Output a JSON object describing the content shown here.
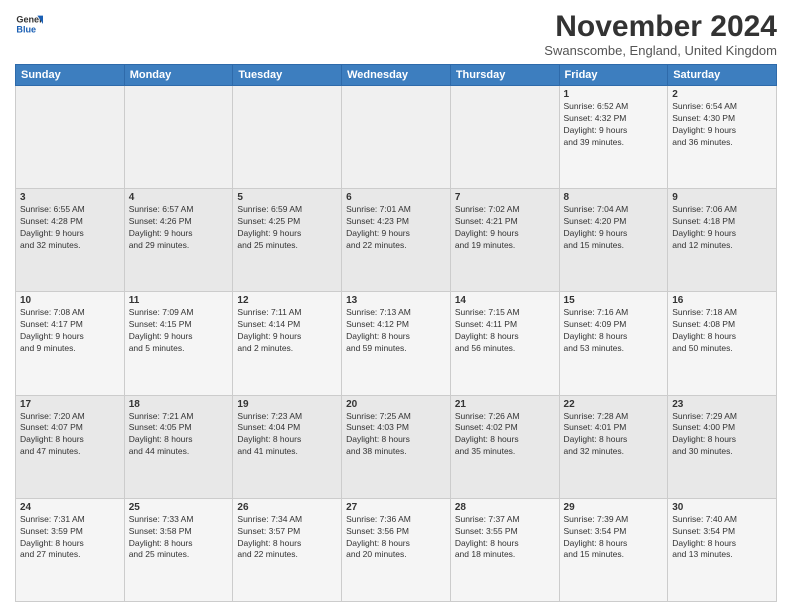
{
  "logo": {
    "line1": "General",
    "line2": "Blue"
  },
  "title": "November 2024",
  "location": "Swanscombe, England, United Kingdom",
  "weekdays": [
    "Sunday",
    "Monday",
    "Tuesday",
    "Wednesday",
    "Thursday",
    "Friday",
    "Saturday"
  ],
  "weeks": [
    [
      {
        "day": "",
        "info": ""
      },
      {
        "day": "",
        "info": ""
      },
      {
        "day": "",
        "info": ""
      },
      {
        "day": "",
        "info": ""
      },
      {
        "day": "",
        "info": ""
      },
      {
        "day": "1",
        "info": "Sunrise: 6:52 AM\nSunset: 4:32 PM\nDaylight: 9 hours\nand 39 minutes."
      },
      {
        "day": "2",
        "info": "Sunrise: 6:54 AM\nSunset: 4:30 PM\nDaylight: 9 hours\nand 36 minutes."
      }
    ],
    [
      {
        "day": "3",
        "info": "Sunrise: 6:55 AM\nSunset: 4:28 PM\nDaylight: 9 hours\nand 32 minutes."
      },
      {
        "day": "4",
        "info": "Sunrise: 6:57 AM\nSunset: 4:26 PM\nDaylight: 9 hours\nand 29 minutes."
      },
      {
        "day": "5",
        "info": "Sunrise: 6:59 AM\nSunset: 4:25 PM\nDaylight: 9 hours\nand 25 minutes."
      },
      {
        "day": "6",
        "info": "Sunrise: 7:01 AM\nSunset: 4:23 PM\nDaylight: 9 hours\nand 22 minutes."
      },
      {
        "day": "7",
        "info": "Sunrise: 7:02 AM\nSunset: 4:21 PM\nDaylight: 9 hours\nand 19 minutes."
      },
      {
        "day": "8",
        "info": "Sunrise: 7:04 AM\nSunset: 4:20 PM\nDaylight: 9 hours\nand 15 minutes."
      },
      {
        "day": "9",
        "info": "Sunrise: 7:06 AM\nSunset: 4:18 PM\nDaylight: 9 hours\nand 12 minutes."
      }
    ],
    [
      {
        "day": "10",
        "info": "Sunrise: 7:08 AM\nSunset: 4:17 PM\nDaylight: 9 hours\nand 9 minutes."
      },
      {
        "day": "11",
        "info": "Sunrise: 7:09 AM\nSunset: 4:15 PM\nDaylight: 9 hours\nand 5 minutes."
      },
      {
        "day": "12",
        "info": "Sunrise: 7:11 AM\nSunset: 4:14 PM\nDaylight: 9 hours\nand 2 minutes."
      },
      {
        "day": "13",
        "info": "Sunrise: 7:13 AM\nSunset: 4:12 PM\nDaylight: 8 hours\nand 59 minutes."
      },
      {
        "day": "14",
        "info": "Sunrise: 7:15 AM\nSunset: 4:11 PM\nDaylight: 8 hours\nand 56 minutes."
      },
      {
        "day": "15",
        "info": "Sunrise: 7:16 AM\nSunset: 4:09 PM\nDaylight: 8 hours\nand 53 minutes."
      },
      {
        "day": "16",
        "info": "Sunrise: 7:18 AM\nSunset: 4:08 PM\nDaylight: 8 hours\nand 50 minutes."
      }
    ],
    [
      {
        "day": "17",
        "info": "Sunrise: 7:20 AM\nSunset: 4:07 PM\nDaylight: 8 hours\nand 47 minutes."
      },
      {
        "day": "18",
        "info": "Sunrise: 7:21 AM\nSunset: 4:05 PM\nDaylight: 8 hours\nand 44 minutes."
      },
      {
        "day": "19",
        "info": "Sunrise: 7:23 AM\nSunset: 4:04 PM\nDaylight: 8 hours\nand 41 minutes."
      },
      {
        "day": "20",
        "info": "Sunrise: 7:25 AM\nSunset: 4:03 PM\nDaylight: 8 hours\nand 38 minutes."
      },
      {
        "day": "21",
        "info": "Sunrise: 7:26 AM\nSunset: 4:02 PM\nDaylight: 8 hours\nand 35 minutes."
      },
      {
        "day": "22",
        "info": "Sunrise: 7:28 AM\nSunset: 4:01 PM\nDaylight: 8 hours\nand 32 minutes."
      },
      {
        "day": "23",
        "info": "Sunrise: 7:29 AM\nSunset: 4:00 PM\nDaylight: 8 hours\nand 30 minutes."
      }
    ],
    [
      {
        "day": "24",
        "info": "Sunrise: 7:31 AM\nSunset: 3:59 PM\nDaylight: 8 hours\nand 27 minutes."
      },
      {
        "day": "25",
        "info": "Sunrise: 7:33 AM\nSunset: 3:58 PM\nDaylight: 8 hours\nand 25 minutes."
      },
      {
        "day": "26",
        "info": "Sunrise: 7:34 AM\nSunset: 3:57 PM\nDaylight: 8 hours\nand 22 minutes."
      },
      {
        "day": "27",
        "info": "Sunrise: 7:36 AM\nSunset: 3:56 PM\nDaylight: 8 hours\nand 20 minutes."
      },
      {
        "day": "28",
        "info": "Sunrise: 7:37 AM\nSunset: 3:55 PM\nDaylight: 8 hours\nand 18 minutes."
      },
      {
        "day": "29",
        "info": "Sunrise: 7:39 AM\nSunset: 3:54 PM\nDaylight: 8 hours\nand 15 minutes."
      },
      {
        "day": "30",
        "info": "Sunrise: 7:40 AM\nSunset: 3:54 PM\nDaylight: 8 hours\nand 13 minutes."
      }
    ]
  ]
}
